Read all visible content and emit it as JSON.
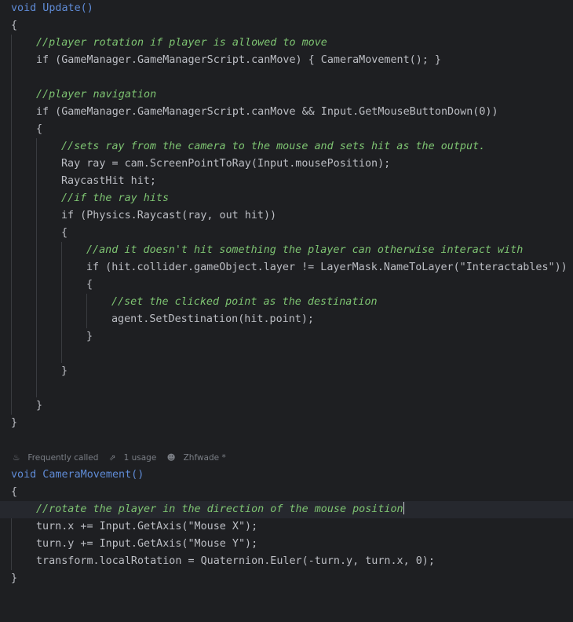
{
  "editor": {
    "code_lines": [
      "void Update()",
      "{",
      "//player rotation if player is allowed to move",
      "if (GameManager.GameManagerScript.canMove) { CameraMovement(); }",
      "",
      "//player navigation",
      "if (GameManager.GameManagerScript.canMove && Input.GetMouseButtonDown(0))",
      "{",
      "//sets ray from the camera to the mouse and sets hit as the output.",
      "Ray ray = cam.ScreenPointToRay(Input.mousePosition);",
      "RaycastHit hit;",
      "//if the ray hits",
      "if (Physics.Raycast(ray, out hit))",
      "{",
      "//and it doesn't hit something the player can otherwise interact with",
      "if (hit.collider.gameObject.layer != LayerMask.NameToLayer(\"Interactables\"))",
      "{",
      "//set the clicked point as the destination",
      "agent.SetDestination(hit.point);",
      "}",
      "}",
      "}",
      "}",
      "void CameraMovement()",
      "{",
      "//rotate the player in the direction of the mouse position",
      "turn.x += Input.GetAxis(\"Mouse X\");",
      "turn.y += Input.GetAxis(\"Mouse Y\");",
      "transform.localRotation = Quaternion.Euler(-turn.y, turn.x, 0);",
      "}"
    ],
    "code_vision": {
      "frequently_called": "Frequently called",
      "usages": "1 usage",
      "author": "Zhfwade *"
    },
    "icons": {
      "frequently_called": "flame-icon",
      "usages": "usages-arrow-icon",
      "author": "person-icon"
    },
    "colors": {
      "background": "#1e1f22",
      "keyword": "#5f8bd6",
      "comment": "#7ec472",
      "type": "#c77dbb",
      "member": "#56b6c2",
      "string": "#6aab73",
      "number": "#2aacb8"
    }
  }
}
